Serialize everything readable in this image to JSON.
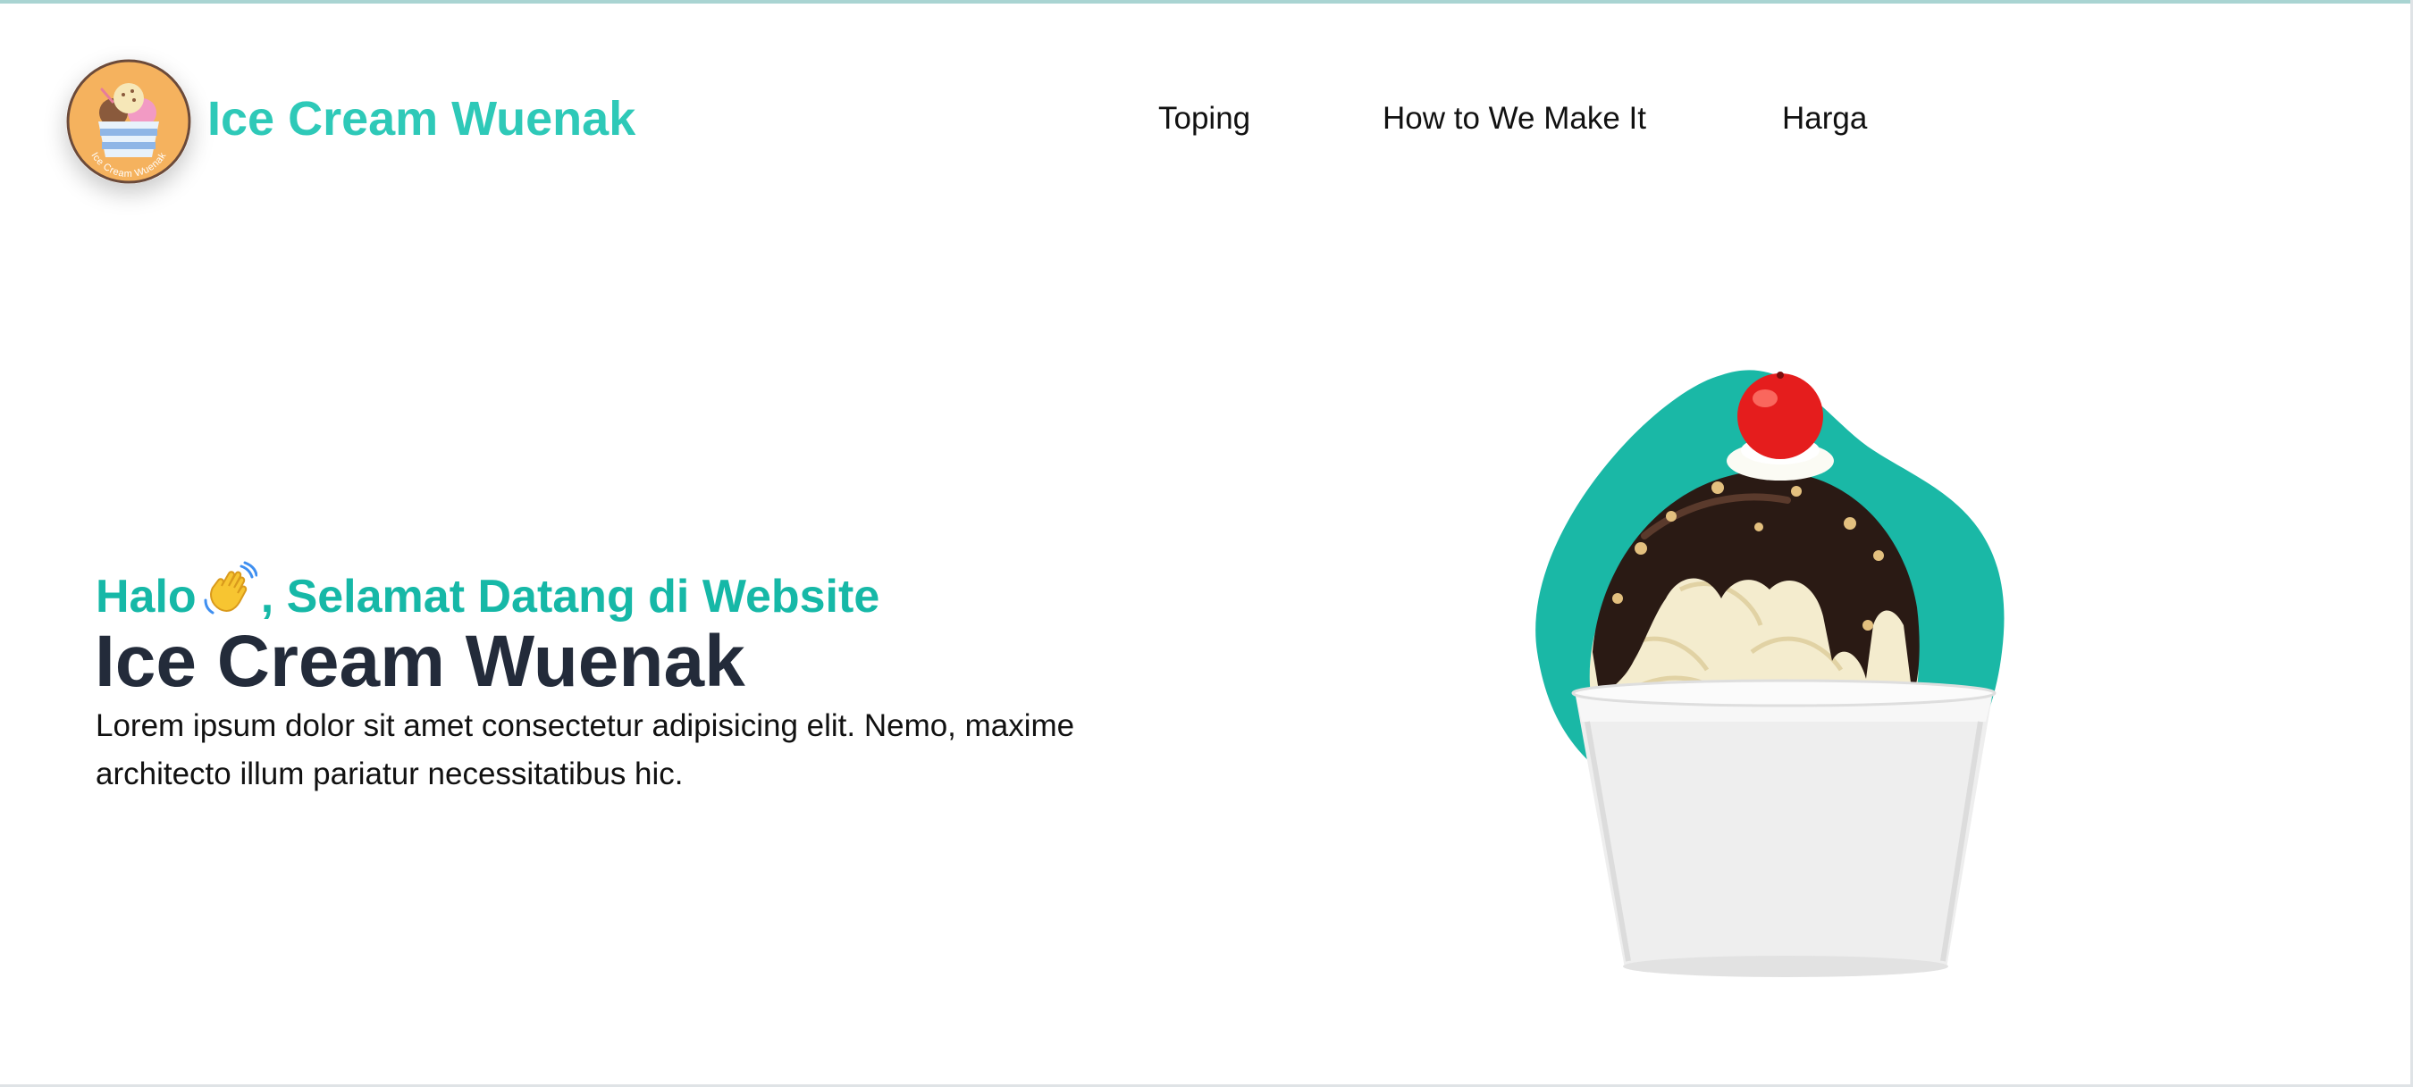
{
  "header": {
    "logo_text": "Ice Cream Wuenak",
    "brand": "Ice Cream Wuenak",
    "nav": [
      "Toping",
      "How to We Make It",
      "Harga"
    ]
  },
  "hero": {
    "greeting_before": "Halo",
    "greeting_after": ", Selamat Datang di Website",
    "title": "Ice Cream Wuenak",
    "description": "Lorem ipsum dolor sit amet consectetur adipisicing elit. Nemo, maxime architecto illum pariatur necessitatibus hic."
  },
  "icons": {
    "logo": "ice-cream-logo-icon",
    "greeting": "waving-hand-icon",
    "hero": "ice-cream-sundae-cup"
  },
  "colors": {
    "accent": "#2ec9b8",
    "accent_dark": "#16b8a7",
    "heading": "#232b3a",
    "logo_bg": "#f5b25e",
    "blob": "#1ab8a6"
  }
}
